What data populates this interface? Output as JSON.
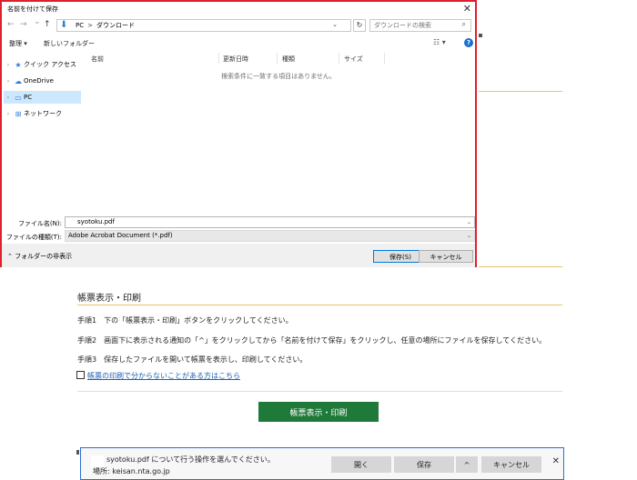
{
  "dialog": {
    "title": "名前を付けて保存",
    "close_glyph": "✕",
    "nav": {
      "back": "←",
      "forward": "→",
      "dropdown": "⌄",
      "up": "↑"
    },
    "address": {
      "crumbs": [
        "PC",
        "ダウンロード"
      ],
      "separator": ">",
      "chevron": "⌄"
    },
    "refresh_glyph": "↻",
    "search_placeholder": "ダウンロードの検索",
    "toolbar": {
      "organize": "整理 ▾",
      "new_folder": "新しいフォルダー",
      "view_glyph": "☷ ▾",
      "help_glyph": "?"
    },
    "sidebar": {
      "items": [
        {
          "label": "クイック アクセス",
          "icon": "star-icon",
          "glyph": "★"
        },
        {
          "label": "OneDrive",
          "icon": "cloud-icon",
          "glyph": "☁"
        },
        {
          "label": "PC",
          "icon": "pc-icon",
          "glyph": "▭",
          "selected": true
        },
        {
          "label": "ネットワーク",
          "icon": "network-icon",
          "glyph": "⊞"
        }
      ]
    },
    "columns": [
      "名前",
      "更新日時",
      "種類",
      "サイズ"
    ],
    "empty_message": "検索条件に一致する項目はありません。",
    "filename_label": "ファイル名(N):",
    "filename_value": "syotoku.pdf",
    "filetype_label": "ファイルの種類(T):",
    "filetype_value": "Adobe Acrobat Document (*.pdf)",
    "hide_folders": "フォルダーの非表示",
    "save_button": "保存(S)",
    "cancel_button": "キャンセル"
  },
  "page": {
    "section_title": "帳票表示・印刷",
    "steps": [
      "手順1　下の「帳票表示・印刷」ボタンをクリックしてください。",
      "手順2　画面下に表示される通知の「^」をクリックしてから「名前を付けて保存」をクリックし、任意の場所にファイルを保存してください。",
      "手順3　保存したファイルを開いて帳票を表示し、印刷してください。"
    ],
    "help_link": "帳票の印刷で分からないことがある方はこちら",
    "print_button": "帳票表示・印刷",
    "accent_color": "#1f7a3a"
  },
  "notification": {
    "message": "syotoku.pdf について行う操作を選んでください。",
    "location": "場所: keisan.nta.go.jp",
    "open_button": "開く",
    "save_button": "保存",
    "menu_glyph": "^",
    "cancel_button": "キャンセル",
    "close_glyph": "✕"
  }
}
